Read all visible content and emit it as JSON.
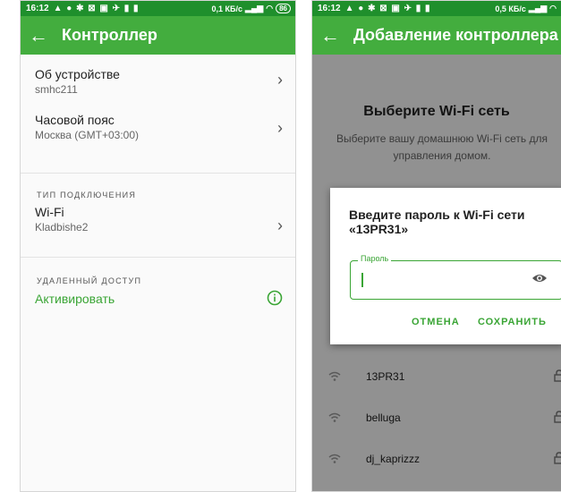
{
  "left": {
    "status": {
      "time": "16:12",
      "icons": "▲ ● ✱ ⊠ ▣ ✈ ▮ ▮",
      "speed": "0,1 КБ/с",
      "battery": "86"
    },
    "appbar": {
      "title": "Контроллер"
    },
    "rows": {
      "about": {
        "title": "Об устройстве",
        "subtitle": "smhc211"
      },
      "timezone": {
        "title": "Часовой пояс",
        "subtitle": "Москва (GMT+03:00)"
      },
      "wifi": {
        "title": "Wi-Fi",
        "subtitle": "Kladbishe2"
      }
    },
    "sections": {
      "connection": "ТИП ПОДКЛЮЧЕНИЯ",
      "remote": "УДАЛЕННЫЙ ДОСТУП"
    },
    "activate": {
      "label": "Активировать"
    }
  },
  "right": {
    "status": {
      "time": "16:12",
      "icons": "▲ ● ✱ ⊠ ▣ ✈ ▮ ▮",
      "speed": "0,5 КБ/с"
    },
    "appbar": {
      "title": "Добавление контроллера"
    },
    "heading": "Выберите Wi-Fi сеть",
    "subtext": "Выберите вашу домашнюю Wi-Fi сеть для управления домом.",
    "dialog": {
      "title": "Введите пароль к Wi-Fi сети «13PR31»",
      "field_label": "Пароль",
      "field_value": "",
      "cancel": "ОТМЕНА",
      "save": "СОХРАНИТЬ"
    },
    "networks": [
      "13PR31",
      "belluga",
      "dj_kaprizzz"
    ]
  },
  "colors": {
    "primary": "#43ad3e",
    "status_bar": "#1f8f2c",
    "accent": "#3aa535"
  }
}
